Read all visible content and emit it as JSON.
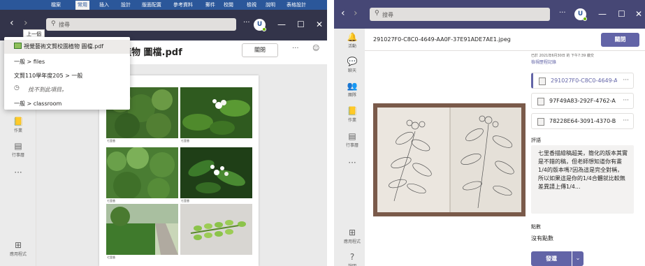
{
  "colors": {
    "teams_purple": "#6264a7",
    "teams_dark": "#33344a",
    "word_blue": "#2b579a",
    "presence_green": "#6bb700"
  },
  "left": {
    "ribbon": {
      "tabs": [
        "檔案",
        "常用",
        "插入",
        "設計",
        "版面配置",
        "參考資料",
        "郵件",
        "校閱",
        "檢視",
        "說明",
        "表格設計"
      ]
    },
    "nav": {
      "back": "‹",
      "forward": "›"
    },
    "tooltip": "上一個",
    "search": {
      "placeholder": "搜尋"
    },
    "avatar": "U",
    "top_icons": {
      "more": "···",
      "minimize": "—",
      "maximize": "☐",
      "close": "✕"
    },
    "dropdown": [
      {
        "label": "視覺藝術文賢校園植物 圖檔.pdf"
      },
      {
        "label": "一般 > files"
      },
      {
        "label": "文賢110學年度205 > 一般"
      },
      {
        "label": "找不到此項目。"
      },
      {
        "label": "一般 > classroom"
      }
    ],
    "file_title": "植物 圖檔.pdf",
    "close_label": "關閉",
    "more": "···",
    "rail": [
      {
        "icon": "📒",
        "label": "作業"
      },
      {
        "icon": "▤",
        "label": "行事曆"
      },
      {
        "icon": "···",
        "label": ""
      },
      {
        "icon": "⊞",
        "label": "應用程式"
      }
    ],
    "captions": [
      "七里香",
      "七里香",
      "七里香",
      "七里香",
      "七里香",
      ""
    ]
  },
  "right": {
    "nav": {
      "back": "‹",
      "forward": "›"
    },
    "search": {
      "placeholder": "搜尋"
    },
    "avatar": "U",
    "top_icons": {
      "more": "···",
      "minimize": "—",
      "maximize": "☐",
      "close": "✕"
    },
    "rail": [
      {
        "icon": "🔔",
        "label": "活動"
      },
      {
        "icon": "💬",
        "label": "聊天"
      },
      {
        "icon": "👥",
        "label": "團隊"
      },
      {
        "icon": "📒",
        "label": "作業"
      },
      {
        "icon": "▤",
        "label": "行事曆"
      },
      {
        "icon": "···",
        "label": ""
      },
      {
        "icon": "⊞",
        "label": "應用程式"
      },
      {
        "icon": "?",
        "label": "說明"
      }
    ],
    "file_name": "291027F0-C8C0-4649-AA0F-37E91ADE7AE1.jpeg",
    "close_label": "關閉",
    "meta": "已於 2021年6月30日 的 下午7:39 繳交",
    "meta_link": "檢視歷程記錄",
    "attachments": [
      {
        "name": "291027F0-C8C0-4649-A",
        "selected": true
      },
      {
        "name": "97F49A83-292F-4762-A",
        "selected": false
      },
      {
        "name": "78228E64-3091-4370-B",
        "selected": false
      }
    ],
    "attach_more": "···",
    "comment_label": "評語",
    "comment": "七里香描繪稿超美，簡化的版本其實是不錯的稿，但老師想知道你有畫1/4的版本嗎?因為這是完全對稱，所以如果這是你的1/4合體就比較無差異請上傳1/4...",
    "points_label": "點數",
    "points_value": "沒有點數",
    "return_label": "發還",
    "return_arrow": "⌄"
  }
}
